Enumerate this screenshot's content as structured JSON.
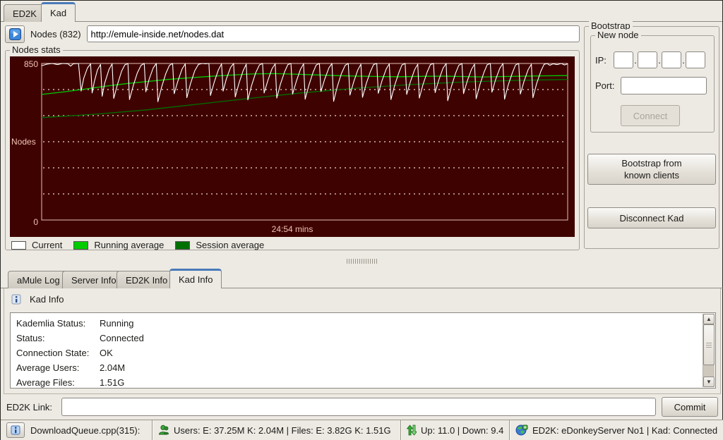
{
  "top_tabs": [
    {
      "label": "ED2K",
      "active": false
    },
    {
      "label": "Kad",
      "active": true
    }
  ],
  "nodes_row": {
    "download_icon": "play-download-icon",
    "nodes_label": "Nodes (832)",
    "url_value": "http://emule-inside.net/nodes.dat"
  },
  "nodes_stats": {
    "group_label": "Nodes stats"
  },
  "chart_data": {
    "type": "line",
    "title": "Nodes stats",
    "xlabel": "24:54 mins",
    "ylabel": "Nodes",
    "y_tick_top": "850",
    "y_tick_bottom": "0",
    "ylim": [
      0,
      850
    ],
    "x_range_percent": [
      0,
      100
    ],
    "gridlines": 5,
    "grid_style": "dotted",
    "background": "#3E0301",
    "legend_position": "bottom-left",
    "series": [
      {
        "name": "Current",
        "color": "#ffffff",
        "points": [
          [
            0,
            838
          ],
          [
            1,
            846
          ],
          [
            2,
            850
          ],
          [
            3,
            844
          ],
          [
            4,
            850
          ],
          [
            5,
            848
          ],
          [
            5.5,
            836
          ],
          [
            6,
            848
          ],
          [
            7,
            850
          ],
          [
            7.5,
            700
          ],
          [
            8,
            770
          ],
          [
            8.7,
            825
          ],
          [
            9.3,
            848
          ],
          [
            9.6,
            690
          ],
          [
            10,
            750
          ],
          [
            10.6,
            815
          ],
          [
            11.2,
            845
          ],
          [
            11.5,
            672
          ],
          [
            12,
            745
          ],
          [
            12.8,
            818
          ],
          [
            13.4,
            848
          ],
          [
            13.7,
            660
          ],
          [
            14.4,
            735
          ],
          [
            15.2,
            808
          ],
          [
            15.8,
            842
          ],
          [
            16.4,
            850
          ],
          [
            16.7,
            654
          ],
          [
            17.4,
            728
          ],
          [
            18.2,
            800
          ],
          [
            18.9,
            840
          ],
          [
            19.5,
            850
          ],
          [
            19.8,
            696
          ],
          [
            20.4,
            762
          ],
          [
            21.2,
            825
          ],
          [
            21.8,
            850
          ],
          [
            22.1,
            642
          ],
          [
            22.8,
            722
          ],
          [
            23.6,
            795
          ],
          [
            24.3,
            840
          ],
          [
            24.9,
            850
          ],
          [
            25.2,
            686
          ],
          [
            25.9,
            755
          ],
          [
            26.7,
            820
          ],
          [
            27.3,
            848
          ],
          [
            27.6,
            664
          ],
          [
            28.3,
            740
          ],
          [
            29.1,
            810
          ],
          [
            29.8,
            845
          ],
          [
            30.5,
            850
          ],
          [
            31.2,
            848
          ],
          [
            31.8,
            850
          ],
          [
            32.1,
            676
          ],
          [
            32.8,
            748
          ],
          [
            33.6,
            815
          ],
          [
            34.2,
            848
          ],
          [
            34.5,
            700
          ],
          [
            35.1,
            765
          ],
          [
            35.9,
            828
          ],
          [
            36.5,
            850
          ],
          [
            36.8,
            668
          ],
          [
            37.5,
            742
          ],
          [
            38.3,
            810
          ],
          [
            38.9,
            846
          ],
          [
            39.2,
            652
          ],
          [
            39.9,
            730
          ],
          [
            40.7,
            800
          ],
          [
            41.4,
            842
          ],
          [
            42,
            850
          ],
          [
            42.3,
            690
          ],
          [
            43,
            758
          ],
          [
            43.8,
            822
          ],
          [
            44.4,
            848
          ],
          [
            44.7,
            662
          ],
          [
            45.4,
            738
          ],
          [
            46.2,
            806
          ],
          [
            46.8,
            844
          ],
          [
            47.4,
            850
          ],
          [
            47.7,
            684
          ],
          [
            48.4,
            752
          ],
          [
            49.2,
            818
          ],
          [
            49.8,
            848
          ],
          [
            50.1,
            656
          ],
          [
            50.8,
            732
          ],
          [
            51.6,
            802
          ],
          [
            52.2,
            842
          ],
          [
            52.8,
            850
          ],
          [
            53.1,
            698
          ],
          [
            53.8,
            764
          ],
          [
            54.6,
            826
          ],
          [
            55.2,
            850
          ],
          [
            55.5,
            644
          ],
          [
            56.2,
            724
          ],
          [
            57,
            796
          ],
          [
            57.7,
            840
          ],
          [
            58.3,
            850
          ],
          [
            58.6,
            678
          ],
          [
            59.3,
            748
          ],
          [
            60.1,
            814
          ],
          [
            60.7,
            846
          ],
          [
            61,
            666
          ],
          [
            61.7,
            740
          ],
          [
            62.5,
            806
          ],
          [
            63.1,
            844
          ],
          [
            63.7,
            850
          ],
          [
            64,
            688
          ],
          [
            64.7,
            756
          ],
          [
            65.5,
            820
          ],
          [
            66.1,
            848
          ],
          [
            66.4,
            654
          ],
          [
            67.1,
            730
          ],
          [
            67.9,
            800
          ],
          [
            68.5,
            842
          ],
          [
            69.1,
            850
          ],
          [
            69.4,
            682
          ],
          [
            70.1,
            750
          ],
          [
            70.9,
            816
          ],
          [
            71.5,
            846
          ],
          [
            71.8,
            662
          ],
          [
            72.5,
            736
          ],
          [
            73.3,
            804
          ],
          [
            73.9,
            844
          ],
          [
            74.5,
            850
          ],
          [
            74.8,
            692
          ],
          [
            75.5,
            760
          ],
          [
            76.3,
            824
          ],
          [
            76.9,
            850
          ],
          [
            77.2,
            648
          ],
          [
            77.9,
            726
          ],
          [
            78.7,
            798
          ],
          [
            79.3,
            840
          ],
          [
            79.9,
            850
          ],
          [
            80.2,
            686
          ],
          [
            80.9,
            754
          ],
          [
            81.7,
            818
          ],
          [
            82.3,
            846
          ],
          [
            82.6,
            658
          ],
          [
            83.3,
            734
          ],
          [
            84.1,
            802
          ],
          [
            84.7,
            843
          ],
          [
            85.3,
            850
          ],
          [
            85.6,
            694
          ],
          [
            86.3,
            762
          ],
          [
            87.1,
            824
          ],
          [
            87.7,
            850
          ],
          [
            88,
            656
          ],
          [
            88.7,
            733
          ],
          [
            89.5,
            801
          ],
          [
            90.1,
            842
          ],
          [
            90.7,
            850
          ],
          [
            91,
            684
          ],
          [
            91.7,
            753
          ],
          [
            92.5,
            817
          ],
          [
            93.1,
            846
          ],
          [
            93.4,
            664
          ],
          [
            94.1,
            740
          ],
          [
            94.9,
            808
          ],
          [
            95.5,
            845
          ],
          [
            96.1,
            850
          ],
          [
            96.6,
            840
          ],
          [
            97.2,
            848
          ],
          [
            98,
            844
          ],
          [
            98.8,
            850
          ],
          [
            99.4,
            842
          ],
          [
            100,
            848
          ]
        ]
      },
      {
        "name": "Running average",
        "color": "#00CC00",
        "points": [
          [
            0,
            682
          ],
          [
            4,
            695
          ],
          [
            8,
            710
          ],
          [
            12,
            726
          ],
          [
            16,
            740
          ],
          [
            20,
            752
          ],
          [
            24,
            763
          ],
          [
            28,
            772
          ],
          [
            32,
            780
          ],
          [
            36,
            787
          ],
          [
            40,
            793
          ],
          [
            44,
            795
          ],
          [
            48,
            792
          ],
          [
            52,
            788
          ],
          [
            56,
            784
          ],
          [
            60,
            781
          ],
          [
            64,
            779
          ],
          [
            68,
            778
          ],
          [
            72,
            780
          ],
          [
            76,
            781
          ],
          [
            80,
            779
          ],
          [
            84,
            777
          ],
          [
            88,
            779
          ],
          [
            92,
            781
          ],
          [
            96,
            783
          ],
          [
            100,
            784
          ]
        ]
      },
      {
        "name": "Session average",
        "color": "#007000",
        "points": [
          [
            0,
            556
          ],
          [
            10,
            574
          ],
          [
            20,
            598
          ],
          [
            30,
            630
          ],
          [
            40,
            662
          ],
          [
            50,
            692
          ],
          [
            60,
            716
          ],
          [
            70,
            735
          ],
          [
            80,
            749
          ],
          [
            90,
            758
          ],
          [
            100,
            763
          ]
        ]
      }
    ]
  },
  "bootstrap": {
    "group_label": "Bootstrap",
    "new_node_label": "New node",
    "ip_label": "IP:",
    "ip_separator": ".",
    "port_label": "Port:",
    "connect_label": "Connect",
    "bootstrap_clients_label_1": "Bootstrap from",
    "bootstrap_clients_label_2": "known clients",
    "disconnect_label": "Disconnect Kad"
  },
  "bottom_tabs": [
    {
      "label": "aMule Log",
      "active": false
    },
    {
      "label": "Server Info",
      "active": false
    },
    {
      "label": "ED2K Info",
      "active": false
    },
    {
      "label": "Kad Info",
      "active": true
    }
  ],
  "kad_info": {
    "header": "Kad Info",
    "rows": [
      {
        "label": "Kademlia Status:",
        "value": "Running"
      },
      {
        "label": "Status:",
        "value": "Connected"
      },
      {
        "label": "Connection State:",
        "value": "OK"
      },
      {
        "label": "Average Users:",
        "value": "2.04M"
      },
      {
        "label": "Average Files:",
        "value": "1.51G"
      }
    ]
  },
  "ed2k_link": {
    "label": "ED2K Link:",
    "value": "",
    "commit_label": "Commit"
  },
  "status_bar": {
    "log_text": "DownloadQueue.cpp(315):",
    "users_text": "Users: E: 37.25M K: 2.04M | Files: E: 3.82G K: 1.51G",
    "updown_text": "Up: 11.0 | Down: 9.4",
    "network_text": "ED2K: eDonkeyServer No1 | Kad: Connected"
  }
}
